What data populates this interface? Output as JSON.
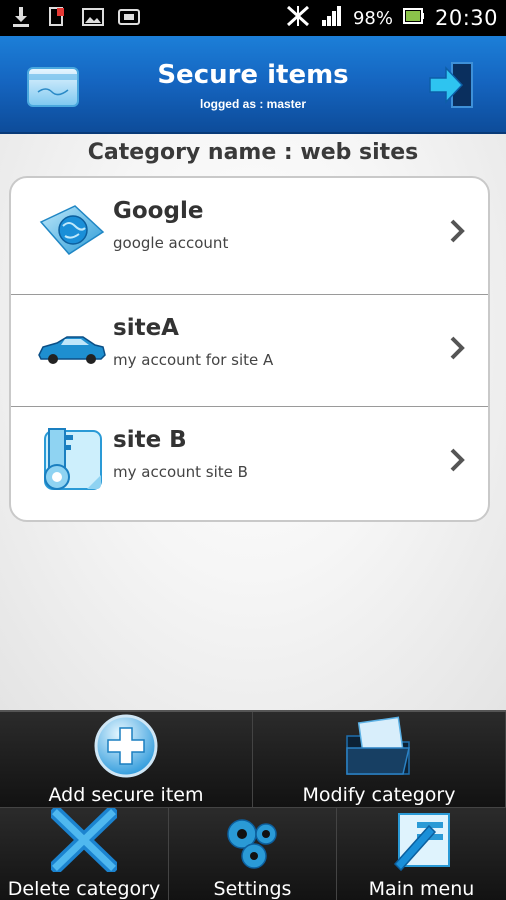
{
  "status_bar": {
    "left_icons": [
      "download-icon",
      "sim-alert-icon",
      "image-icon",
      "card-icon"
    ],
    "battery_percent": "98%",
    "time": "20:30"
  },
  "header": {
    "title": "Secure items",
    "subtitle": "logged as : master",
    "left_icon": "card-icon",
    "right_icon": "logout-icon"
  },
  "category_label": "Category name : web sites",
  "items": [
    {
      "title": "Google",
      "subtitle": "google account",
      "icon": "web-globe-icon"
    },
    {
      "title": "siteA",
      "subtitle": "my account for site A",
      "icon": "car-icon"
    },
    {
      "title": "site B",
      "subtitle": "my account site B",
      "icon": "key-icon"
    }
  ],
  "bottom_bar": {
    "add": "Add secure item",
    "modify": "Modify category",
    "delete": "Delete category",
    "settings": "Settings",
    "main_menu": "Main menu"
  },
  "colors": {
    "header_blue": "#1565c0",
    "accent_cyan": "#29a8e0"
  }
}
